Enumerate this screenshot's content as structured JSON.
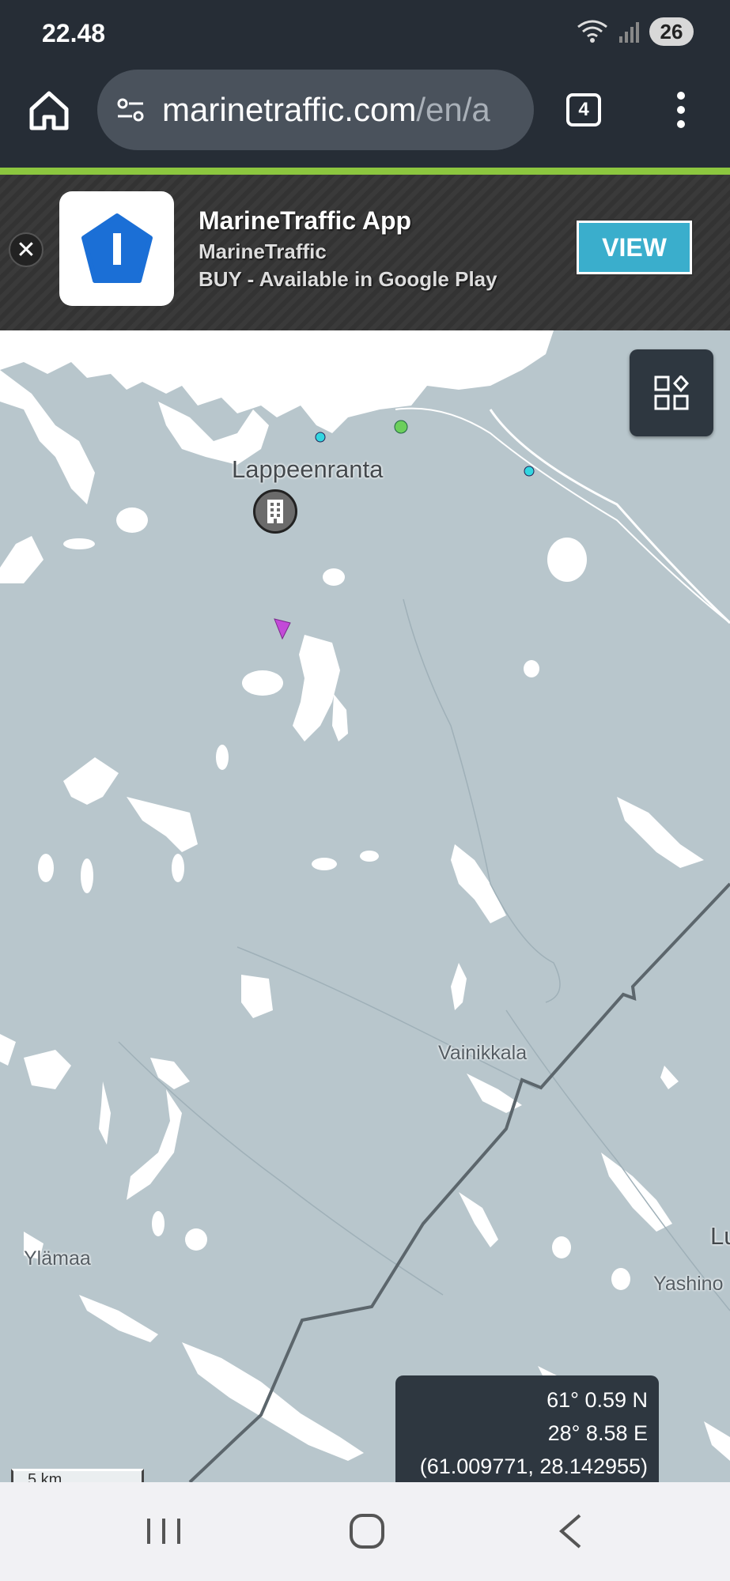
{
  "status_bar": {
    "time": "22.48",
    "battery": "26"
  },
  "browser": {
    "url_host": "marinetraffic.com",
    "url_path": "/en/a",
    "tab_count": "4"
  },
  "banner": {
    "app_title": "MarineTraffic App",
    "developer": "MarineTraffic",
    "availability": "BUY - Available in Google Play",
    "view_label": "VIEW",
    "accent_color": "#8cc63f",
    "button_color": "#3aaecc"
  },
  "map": {
    "places": {
      "lappeenranta": "Lappeenranta",
      "vainikkala": "Vainikkala",
      "ylamaa": "Ylämaa",
      "yashino": "Yashino",
      "lu": "Lu"
    },
    "coordinates": {
      "lat": "61° 0.59 N",
      "lon": "28° 8.58 E",
      "decimal": "(61.009771, 28.142955)"
    },
    "scale_label": "5 km",
    "water_color": "#ffffff",
    "land_color": "#b8c6cc"
  }
}
